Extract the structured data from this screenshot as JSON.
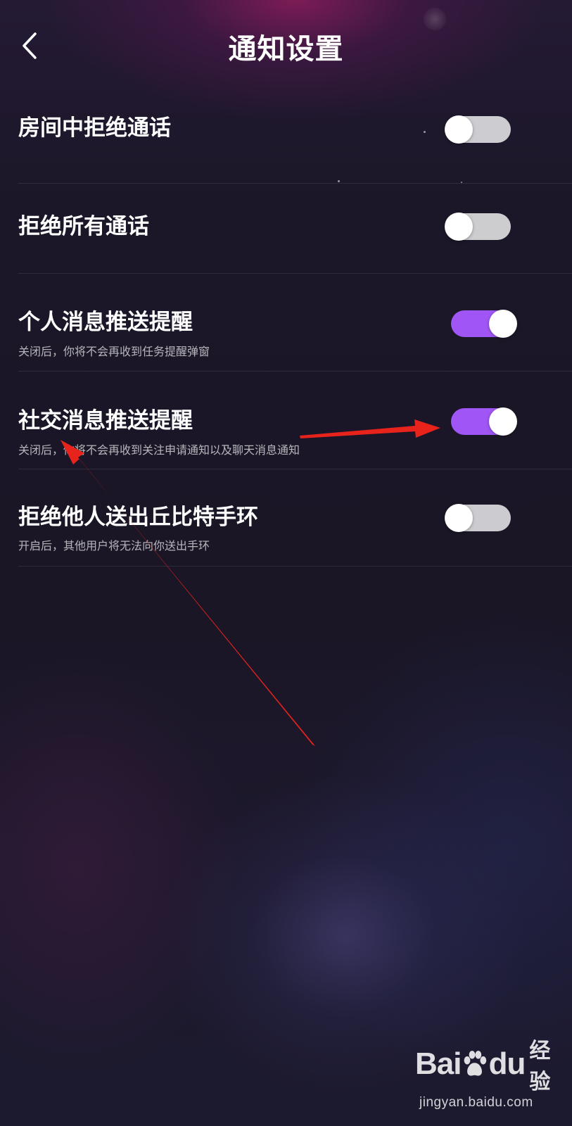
{
  "header": {
    "title": "通知设置",
    "back_icon": "chevron-left-icon"
  },
  "settings": [
    {
      "title": "房间中拒绝通话",
      "description": "",
      "enabled": false
    },
    {
      "title": "拒绝所有通话",
      "description": "",
      "enabled": false
    },
    {
      "title": "个人消息推送提醒",
      "description": "关闭后，你将不会再收到任务提醒弹窗",
      "enabled": true
    },
    {
      "title": "社交消息推送提醒",
      "description": "关闭后，你将不会再收到关注申请通知以及聊天消息通知",
      "enabled": true
    },
    {
      "title": "拒绝他人送出丘比特手环",
      "description": "开启后，其他用户将无法向你送出手环",
      "enabled": false
    }
  ],
  "colors": {
    "toggle_on": "#a056f5",
    "annotation_arrow": "#e8231c"
  },
  "watermark": {
    "brand_left": "Bai",
    "brand_right": "du",
    "brand_suffix": "经验",
    "url": "jingyan.baidu.com",
    "paw_icon": "baidu-paw-icon"
  }
}
